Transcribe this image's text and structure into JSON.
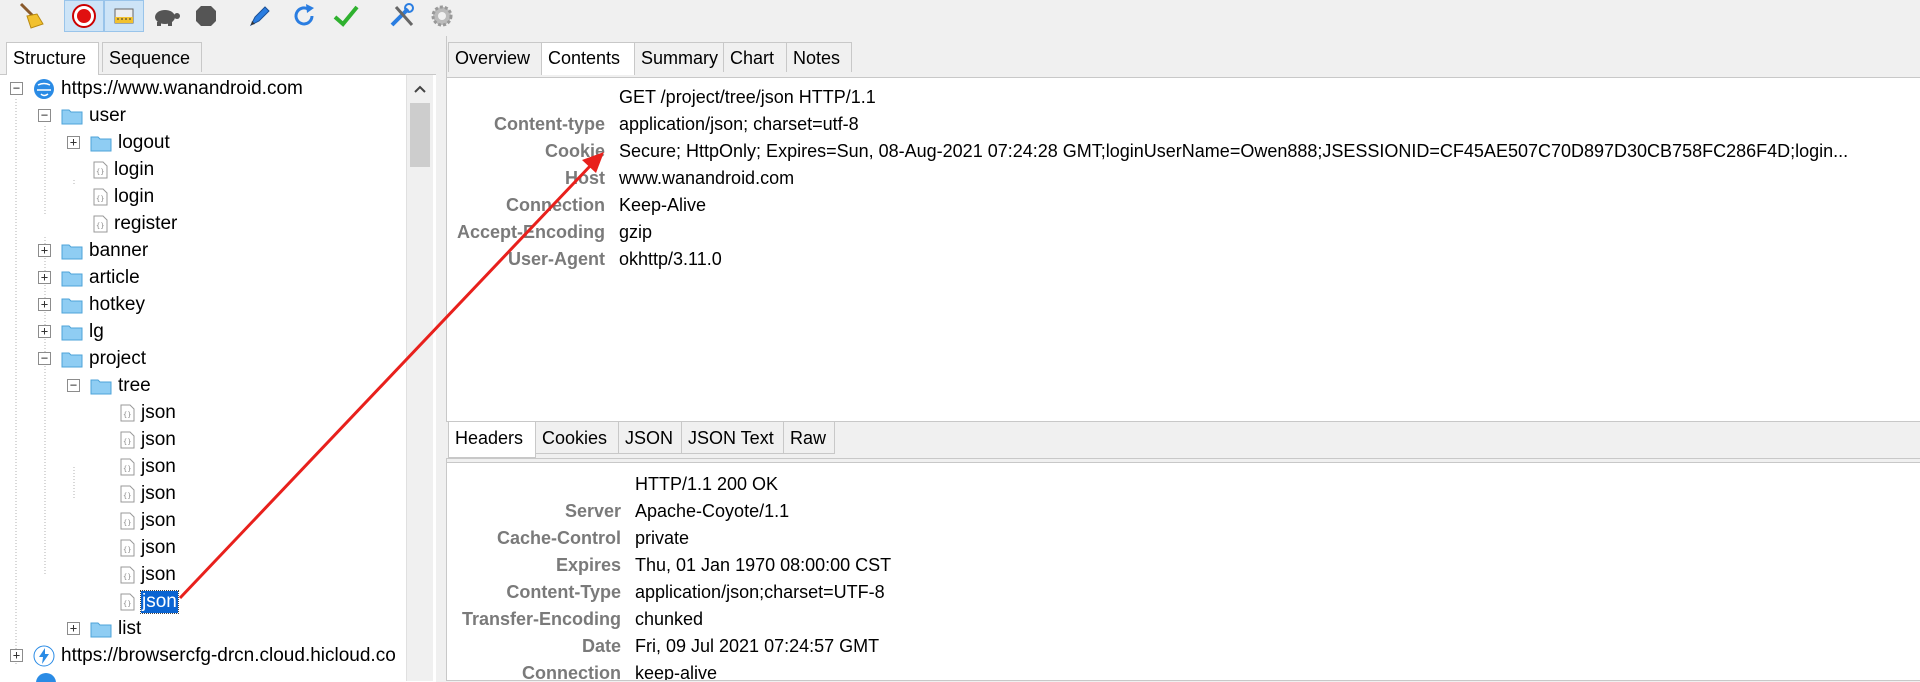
{
  "toolbar": {
    "buttons": [
      {
        "name": "broom-icon"
      },
      {
        "name": "record-icon"
      },
      {
        "name": "throttle-icon"
      },
      {
        "name": "turtle-icon"
      },
      {
        "name": "stop-icon"
      },
      {
        "name": "pen-icon"
      },
      {
        "name": "refresh-icon"
      },
      {
        "name": "check-icon"
      },
      {
        "name": "tools-icon"
      },
      {
        "name": "gear-icon"
      }
    ]
  },
  "left_tabs": [
    "Structure",
    "Sequence"
  ],
  "tree": {
    "root": "https://www.wanandroid.com",
    "user": "user",
    "logout": "logout",
    "login1": "login",
    "login2": "login",
    "register": "register",
    "banner": "banner",
    "article": "article",
    "hotkey": "hotkey",
    "lg": "lg",
    "project": "project",
    "tree": "tree",
    "json_items": [
      "json",
      "json",
      "json",
      "json",
      "json",
      "json",
      "json",
      "json"
    ],
    "list": "list",
    "host2": "https://browsercfg-drcn.cloud.hicloud.co"
  },
  "right_tabs": [
    "Overview",
    "Contents",
    "Summary",
    "Chart",
    "Notes"
  ],
  "request": {
    "first_line": "GET /project/tree/json HTTP/1.1",
    "headers": [
      {
        "key": "Content-type",
        "value": "application/json; charset=utf-8"
      },
      {
        "key": "Cookie",
        "value": "Secure; HttpOnly; Expires=Sun, 08-Aug-2021 07:24:28 GMT;loginUserName=Owen888;JSESSIONID=CF45AE507C70D897D30CB758FC286F4D;login..."
      },
      {
        "key": "Host",
        "value": "www.wanandroid.com"
      },
      {
        "key": "Connection",
        "value": "Keep-Alive"
      },
      {
        "key": "Accept-Encoding",
        "value": "gzip"
      },
      {
        "key": "User-Agent",
        "value": "okhttp/3.11.0"
      }
    ]
  },
  "bottom_tabs": [
    "Headers",
    "Cookies",
    "JSON",
    "JSON Text",
    "Raw"
  ],
  "response": {
    "first_line": "HTTP/1.1 200 OK",
    "headers": [
      {
        "key": "Server",
        "value": "Apache-Coyote/1.1"
      },
      {
        "key": "Cache-Control",
        "value": "private"
      },
      {
        "key": "Expires",
        "value": "Thu, 01 Jan 1970 08:00:00 CST"
      },
      {
        "key": "Content-Type",
        "value": "application/json;charset=UTF-8"
      },
      {
        "key": "Transfer-Encoding",
        "value": "chunked"
      },
      {
        "key": "Date",
        "value": "Fri, 09 Jul 2021 07:24:57 GMT"
      },
      {
        "key": "Connection",
        "value": "keep-alive"
      }
    ]
  },
  "colors": {
    "accent": "#0a64d2",
    "arrow": "#e8201c",
    "folder": "#8fcdf3"
  }
}
